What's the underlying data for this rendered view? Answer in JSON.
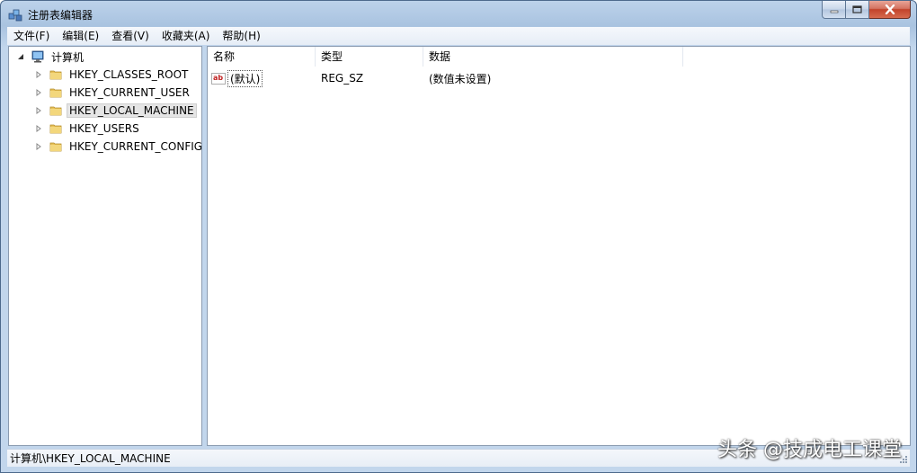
{
  "window": {
    "title": "注册表编辑器",
    "app_icon": "registry-editor-icon"
  },
  "menu": [
    {
      "label": "文件(F)"
    },
    {
      "label": "编辑(E)"
    },
    {
      "label": "查看(V)"
    },
    {
      "label": "收藏夹(A)"
    },
    {
      "label": "帮助(H)"
    }
  ],
  "tree": {
    "root": {
      "label": "计算机",
      "icon": "computer-icon",
      "expanded": true
    },
    "keys": [
      {
        "label": "HKEY_CLASSES_ROOT",
        "icon": "folder-icon",
        "selected": false
      },
      {
        "label": "HKEY_CURRENT_USER",
        "icon": "folder-icon",
        "selected": false
      },
      {
        "label": "HKEY_LOCAL_MACHINE",
        "icon": "folder-icon",
        "selected": true
      },
      {
        "label": "HKEY_USERS",
        "icon": "folder-icon",
        "selected": false
      },
      {
        "label": "HKEY_CURRENT_CONFIG",
        "icon": "folder-icon",
        "selected": false
      }
    ]
  },
  "list": {
    "columns": [
      "名称",
      "类型",
      "数据"
    ],
    "rows": [
      {
        "name": "(默认)",
        "type": "REG_SZ",
        "data": "(数值未设置)",
        "icon": "string-value-icon"
      }
    ]
  },
  "status": {
    "path": "计算机\\HKEY_LOCAL_MACHINE"
  },
  "watermark": "头条 @技成电工课堂",
  "colors": {
    "folder": "#e8c25a",
    "close_button": "#c2432b",
    "frame": "#a9c3e0"
  }
}
